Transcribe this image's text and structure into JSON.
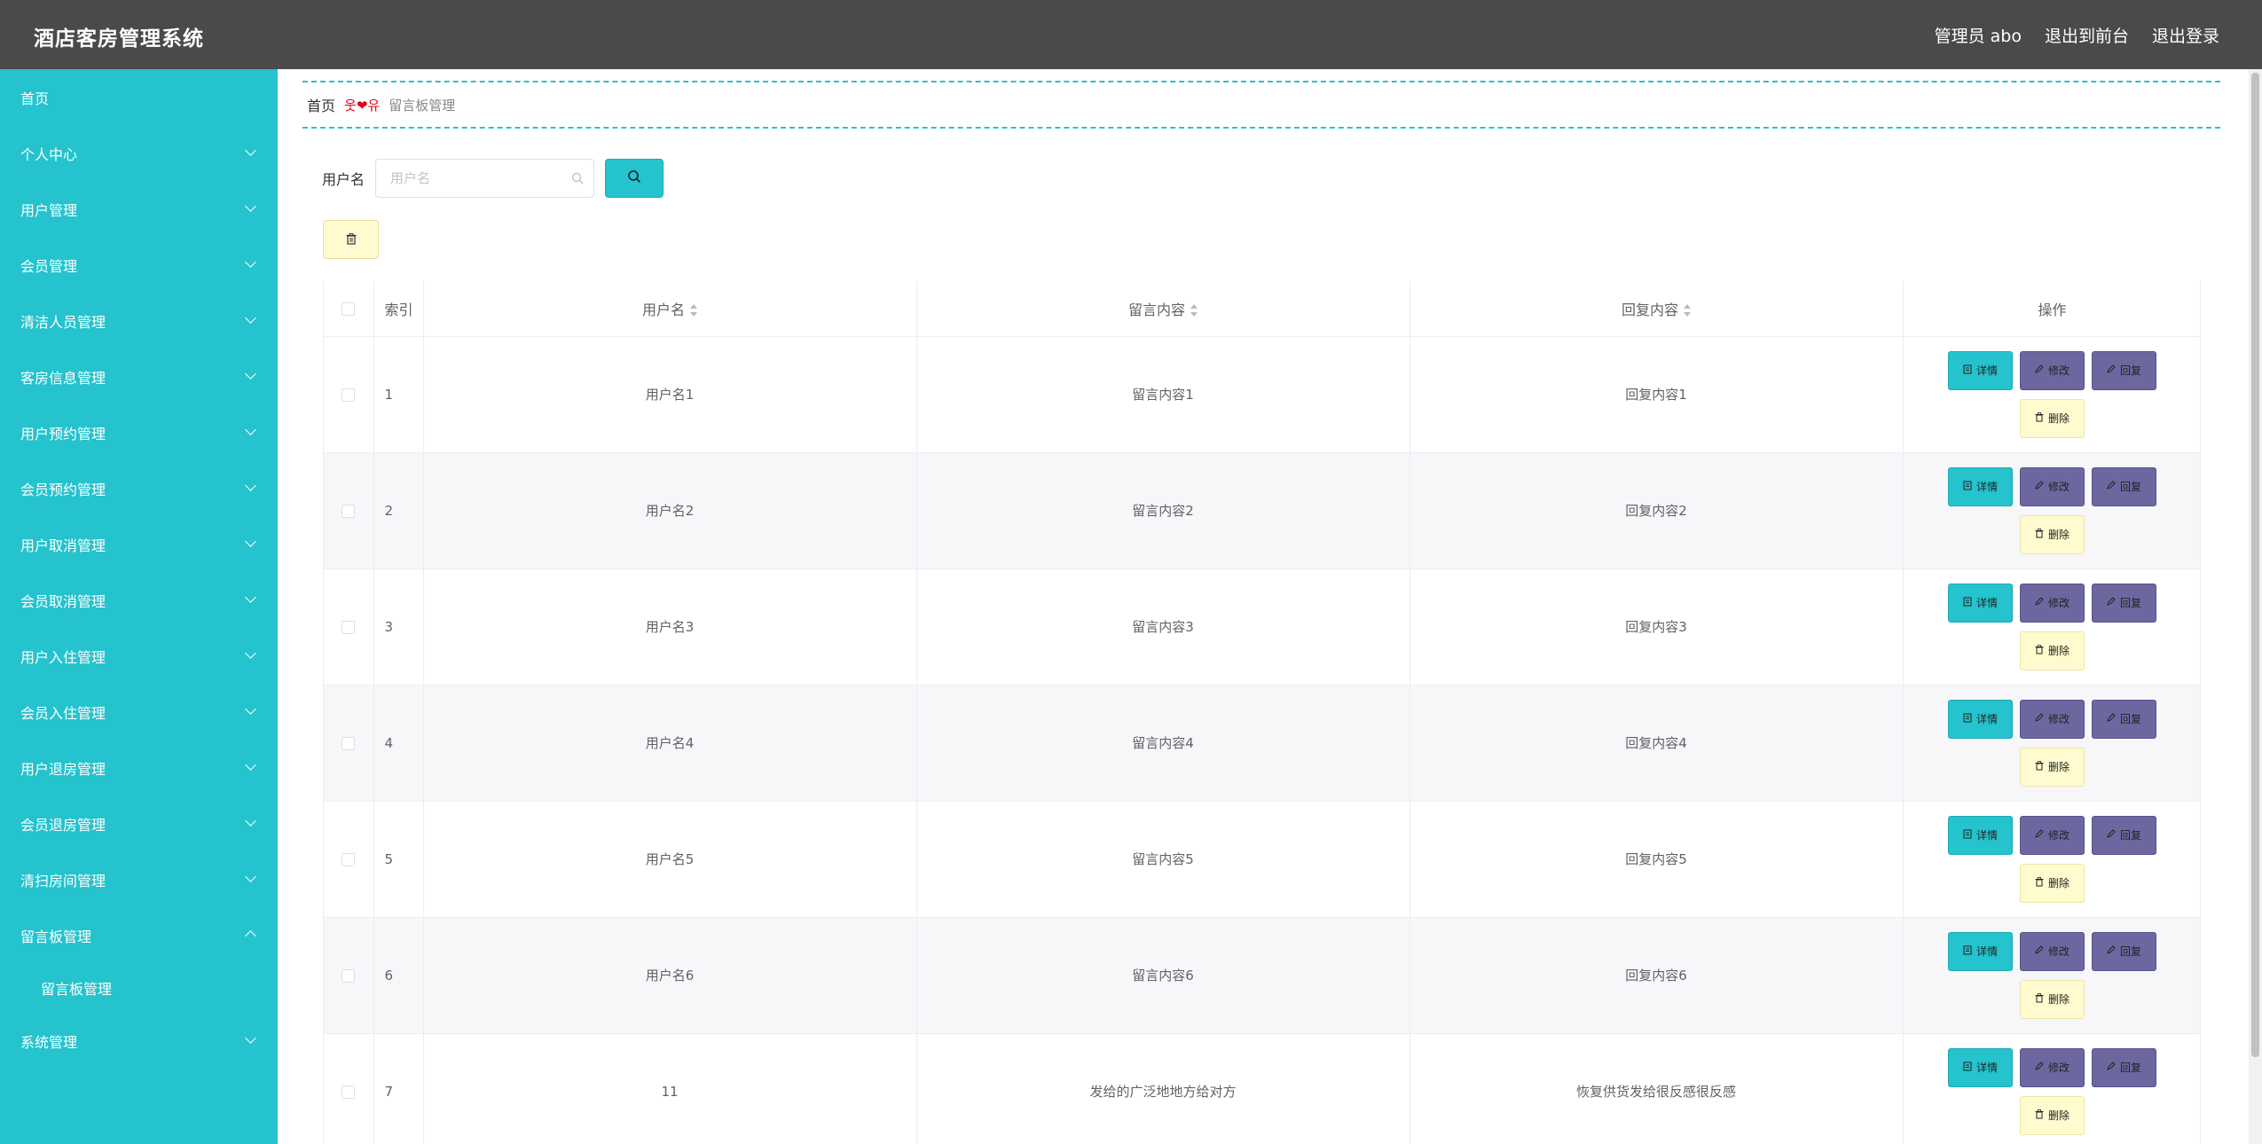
{
  "header": {
    "title": "酒店客房管理系统",
    "admin_label": "管理员 abo",
    "to_front_label": "退出到前台",
    "logout_label": "退出登录"
  },
  "sidebar": {
    "items": [
      {
        "label": "首页",
        "expandable": false
      },
      {
        "label": "个人中心",
        "expandable": true
      },
      {
        "label": "用户管理",
        "expandable": true
      },
      {
        "label": "会员管理",
        "expandable": true
      },
      {
        "label": "清洁人员管理",
        "expandable": true
      },
      {
        "label": "客房信息管理",
        "expandable": true
      },
      {
        "label": "用户预约管理",
        "expandable": true
      },
      {
        "label": "会员预约管理",
        "expandable": true
      },
      {
        "label": "用户取消管理",
        "expandable": true
      },
      {
        "label": "会员取消管理",
        "expandable": true
      },
      {
        "label": "用户入住管理",
        "expandable": true
      },
      {
        "label": "会员入住管理",
        "expandable": true
      },
      {
        "label": "用户退房管理",
        "expandable": true
      },
      {
        "label": "会员退房管理",
        "expandable": true
      },
      {
        "label": "清扫房间管理",
        "expandable": true
      },
      {
        "label": "留言板管理",
        "expandable": true,
        "open": true,
        "children": [
          "留言板管理"
        ]
      },
      {
        "label": "系统管理",
        "expandable": true
      }
    ]
  },
  "breadcrumb": {
    "home": "首页",
    "separator": "웃❤유",
    "current": "留言板管理"
  },
  "search": {
    "label": "用户名",
    "placeholder": "用户名",
    "value": ""
  },
  "table": {
    "columns": {
      "index": "索引",
      "username": "用户名",
      "message": "留言内容",
      "reply": "回复内容",
      "actions": "操作"
    },
    "action_labels": {
      "detail": "详情",
      "edit": "修改",
      "reply": "回复",
      "delete": "删除"
    },
    "rows": [
      {
        "index": "1",
        "username": "用户名1",
        "message": "留言内容1",
        "reply": "回复内容1"
      },
      {
        "index": "2",
        "username": "用户名2",
        "message": "留言内容2",
        "reply": "回复内容2"
      },
      {
        "index": "3",
        "username": "用户名3",
        "message": "留言内容3",
        "reply": "回复内容3"
      },
      {
        "index": "4",
        "username": "用户名4",
        "message": "留言内容4",
        "reply": "回复内容4"
      },
      {
        "index": "5",
        "username": "用户名5",
        "message": "留言内容5",
        "reply": "回复内容5"
      },
      {
        "index": "6",
        "username": "用户名6",
        "message": "留言内容6",
        "reply": "回复内容6"
      },
      {
        "index": "7",
        "username": "11",
        "message": "发给的广泛地地方给对方",
        "reply": "恢复供货发给很反感很反感"
      }
    ]
  },
  "colors": {
    "header_bg": "#4a4a4a",
    "sidebar_bg": "#24c3cd",
    "accent": "#24c3cd",
    "edit_button": "#6d67a0",
    "delete_button": "#fffbcf"
  }
}
